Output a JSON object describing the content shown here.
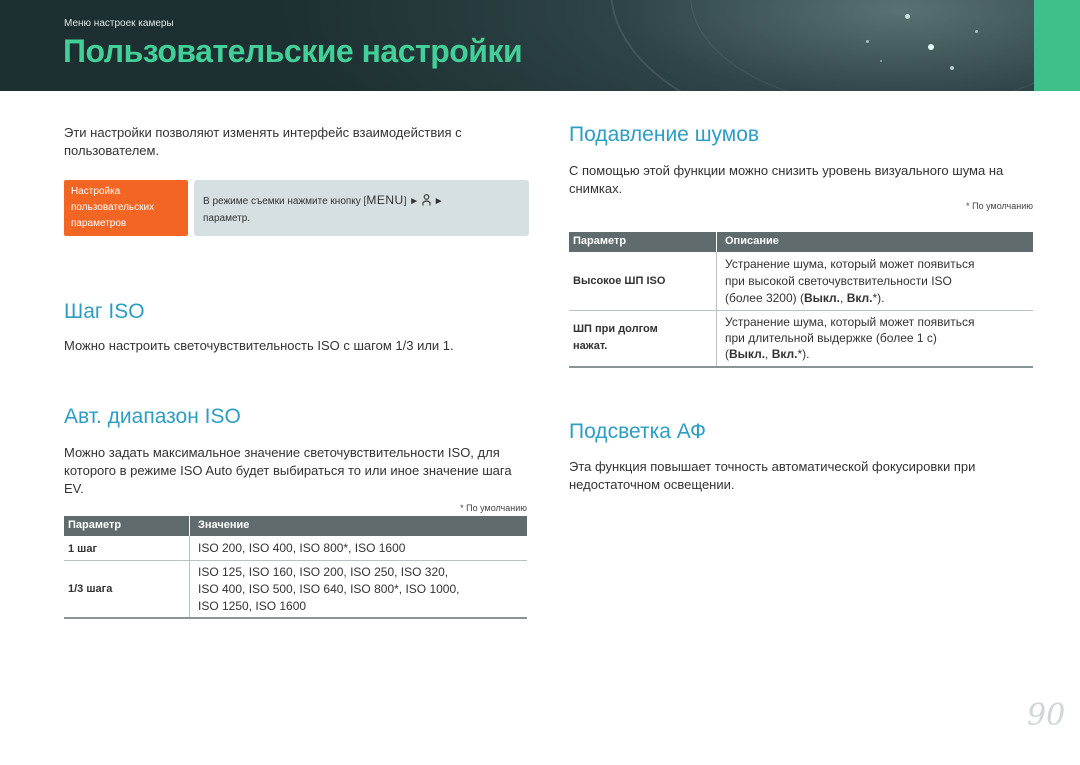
{
  "header": {
    "breadcrumb": "Меню настроек камеры",
    "title": "Пользовательские настройки"
  },
  "intro": {
    "text": "Эти настройки позволяют изменять интерфейс взаимодействия с пользователем.",
    "path_label": "Настройка пользовательских параметров",
    "path_text_before": "В режиме съемки нажмите кнопку [",
    "path_menu_key": "MENU",
    "path_text_mid": "] ►",
    "path_text_after": "►",
    "path_text_end": "параметр."
  },
  "iso_step": {
    "title": "Шаг ISO",
    "text": "Можно настроить светочувствительность ISO с шагом 1/3 или 1."
  },
  "auto_iso": {
    "title": "Авт. диапазон ISO",
    "text": "Можно задать максимальное значение светочувствительности ISO, для которого в режиме ISO Auto будет выбираться то или иное значение шага EV.",
    "footnote": "* По умолчанию",
    "table": {
      "col1": "Параметр",
      "col2": "Значение",
      "rows": [
        {
          "param": "1 шаг",
          "value_lines": [
            "ISO 200, ISO 400, ISO 800*, ISO 1600"
          ]
        },
        {
          "param": "1/3 шага",
          "value_lines": [
            "ISO 125, ISO 160, ISO 200, ISO 250, ISO 320,",
            "ISO 400, ISO 500, ISO 640, ISO 800*, ISO 1000,",
            "ISO 1250, ISO 1600"
          ]
        }
      ]
    }
  },
  "noise": {
    "title": "Подавление шумов",
    "text": "С помощью этой функции можно снизить уровень визуального шума на снимках.",
    "footnote": "* По умолчанию",
    "table": {
      "col1": "Параметр",
      "col2": "Описание",
      "rows": [
        {
          "param_lines": [
            "Высокое ШП ISO"
          ],
          "desc_lines": [
            "Устранение шума, который может появиться",
            "при высокой светочувствительности ISO"
          ],
          "desc_last_prefix": "(более 3200) (",
          "opt_off": "Выкл.",
          "opt_sep": ", ",
          "opt_on": "Вкл.",
          "desc_last_suffix": "*)."
        },
        {
          "param_lines": [
            "ШП при долгом",
            "нажат."
          ],
          "desc_lines": [
            "Устранение шума, который может появиться",
            "при длительной выдержке (более 1 с)"
          ],
          "desc_last_prefix": "(",
          "opt_off": "Выкл.",
          "opt_sep": ", ",
          "opt_on": "Вкл.",
          "desc_last_suffix": "*)."
        }
      ]
    }
  },
  "af_light": {
    "title": "Подсветка АФ",
    "text": "Эта функция повышает точность автоматической фокусировки при недостаточном освещении."
  },
  "page_number": "90",
  "colors": {
    "accent_green": "#43cf98",
    "section_blue": "#2d9dc4",
    "path_orange": "#f26522",
    "table_header": "#5f6b6d"
  }
}
